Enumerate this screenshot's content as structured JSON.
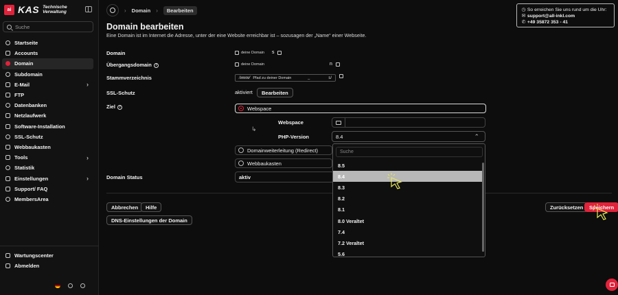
{
  "brand": {
    "logo_mark": "all inkl",
    "name": "KAS",
    "subtitle_line1": "Technische",
    "subtitle_line2": "Verwaltung"
  },
  "sidebar": {
    "search_placeholder": "Suche",
    "items": [
      {
        "label": "Startseite",
        "icon": "home-icon"
      },
      {
        "label": "Accounts",
        "icon": "user-icon"
      },
      {
        "label": "Domain",
        "icon": "globe-icon",
        "active": true
      },
      {
        "label": "Subdomain",
        "icon": "subdomain-icon"
      },
      {
        "label": "E-Mail",
        "icon": "mail-icon",
        "expandable": true
      },
      {
        "label": "FTP",
        "icon": "upload-icon"
      },
      {
        "label": "Datenbanken",
        "icon": "database-icon"
      },
      {
        "label": "Netzlaufwerk",
        "icon": "drive-icon"
      },
      {
        "label": "Software-Installation",
        "icon": "package-icon"
      },
      {
        "label": "SSL-Schutz",
        "icon": "lock-icon"
      },
      {
        "label": "Webbaukasten",
        "icon": "layout-icon"
      },
      {
        "label": "Tools",
        "icon": "wrench-icon",
        "expandable": true
      },
      {
        "label": "Statistik",
        "icon": "chart-icon"
      },
      {
        "label": "Einstellungen",
        "icon": "gear-icon",
        "expandable": true
      },
      {
        "label": "Support/ FAQ",
        "icon": "help-icon"
      },
      {
        "label": "MembersArea",
        "icon": "members-icon"
      }
    ],
    "bottom_items": [
      {
        "label": "Wartungscenter",
        "icon": "tools-icon"
      },
      {
        "label": "Abmelden",
        "icon": "logout-icon"
      }
    ]
  },
  "breadcrumb": {
    "item1": "Domain",
    "item2": "Bearbeiten"
  },
  "contact": {
    "intro": "So erreichen Sie uns rund um die Uhr:",
    "email": "support@all-inkl.com",
    "phone": "+49 35872 353 - 41"
  },
  "page": {
    "title": "Domain bearbeiten",
    "subtitle": "Eine Domain ist im Internet die Adresse, unter der eine Website erreichbar ist – sozusagen der „Name“ einer Webseite."
  },
  "form": {
    "domain_label": "Domain",
    "domain_hint": "deine Domain",
    "domain_suffix": "s",
    "uebergang_label": "Übergangsdomain",
    "uebergang_hint": "deine Domain",
    "uebergang_suffix": "n",
    "root_label": "Stammverzeichnis",
    "root_prefix": "/www/",
    "root_hint": "Pfad zu deiner Domain",
    "root_mid": "_",
    "root_suffix": "s/",
    "ssl_label": "SSL-Schutz",
    "ssl_status": "aktiviert",
    "ssl_button": "Bearbeiten",
    "ziel_label": "Ziel",
    "option_webspace": "Webspace",
    "webspace_label": "Webspace",
    "php_label": "PHP-Version",
    "php_selected": "8.4",
    "option_redirect": "Domainweiterleitung (Redirect)",
    "option_webbaukasten": "Webbaukasten",
    "status_label": "Domain Status",
    "status_value": "aktiv"
  },
  "dropdown": {
    "search_placeholder": "Suche",
    "options": [
      "8.5",
      "8.4",
      "8.3",
      "8.2",
      "8.1",
      "8.0 Veraltet",
      "7.4",
      "7.2 Veraltet",
      "5.6"
    ],
    "highlighted": "8.4"
  },
  "actions": {
    "cancel": "Abbrechen",
    "help": "Hilfe",
    "dns": "DNS-Einstellungen der Domain",
    "reset": "Zurücksetzen",
    "save": "Speichern"
  },
  "colors": {
    "accent": "#e0233b",
    "background": "#0d0d0d",
    "sidebar": "#121212"
  }
}
